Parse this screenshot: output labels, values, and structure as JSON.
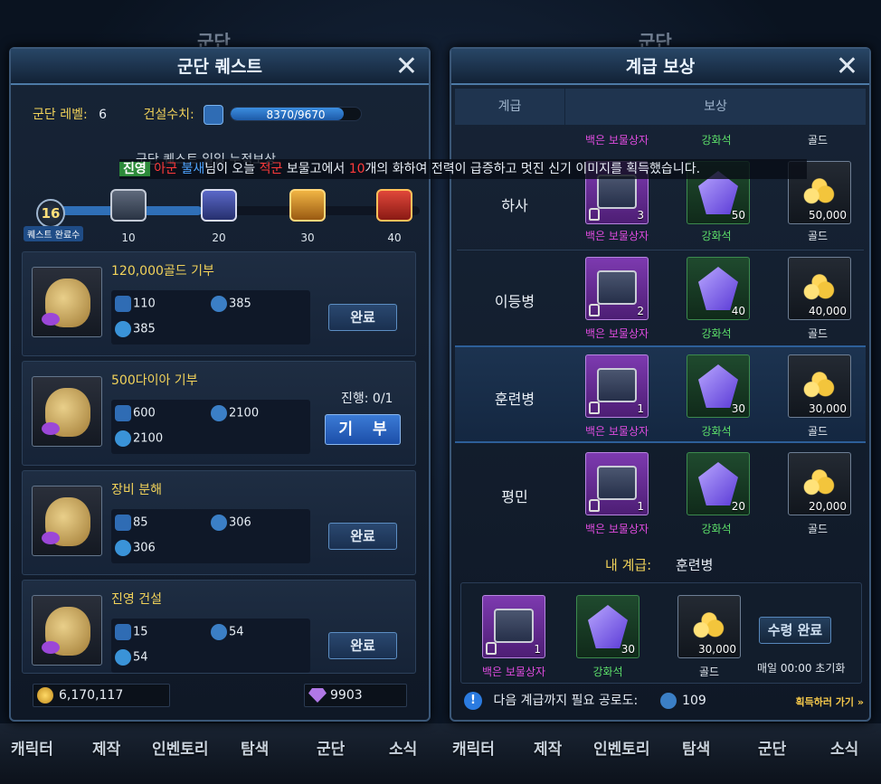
{
  "background": {
    "left_title": "군단",
    "right_title": "군단"
  },
  "bottom_nav": {
    "items": [
      "캐릭터",
      "제작",
      "인벤토리",
      "탐색",
      "군단",
      "소식",
      "캐릭터",
      "제작",
      "인벤토리",
      "탐색",
      "군단",
      "소식"
    ]
  },
  "ticker": {
    "tag": "진영",
    "faction": "아군",
    "player": "불새",
    "msg_1": "님이 오늘",
    "enemy": "적군",
    "msg_2": "보물고에서",
    "count": "10",
    "msg_3": "개의 화하여 전력이 급증하고 멋진 신기 이미지를 획득했습니다."
  },
  "legion_quest": {
    "title": "군단 퀘스트",
    "level_label": "군단 레벨:",
    "level_value": "6",
    "build_label": "건설수치:",
    "build_value": "8370/9670",
    "build_progress": 0.866,
    "daily_reward_caption": "군단 퀘스트 일일 누적보상",
    "completed_count": "16",
    "completed_label": "퀘스트 완료수",
    "milestone_progress": 0.4,
    "milestones": [
      "10",
      "20",
      "30",
      "40"
    ],
    "quests": [
      {
        "title": "120,000골드 기부",
        "build": "110",
        "star": "385",
        "heart": "385",
        "button": "완료"
      },
      {
        "title": "500다이아 기부",
        "build": "600",
        "star": "2100",
        "heart": "2100",
        "progress": "진행: 0/1",
        "button": "기 부"
      },
      {
        "title": "장비 분해",
        "build": "85",
        "star": "306",
        "heart": "306",
        "button": "완료"
      },
      {
        "title": "진영 건설",
        "build": "15",
        "star": "54",
        "heart": "54",
        "button": "완료"
      }
    ],
    "gold": "6,170,117",
    "diamonds": "9903"
  },
  "rank_reward": {
    "title": "계급 보상",
    "col_rank": "계급",
    "col_reward": "보상",
    "top_captions": [
      "백은 보물상자",
      "강화석",
      "골드"
    ],
    "rows": [
      {
        "rank": "하사",
        "box_qty": "3",
        "gem_qty": "50",
        "gold_qty": "50,000"
      },
      {
        "rank": "이등병",
        "box_qty": "2",
        "gem_qty": "40",
        "gold_qty": "40,000"
      },
      {
        "rank": "훈련병",
        "box_qty": "1",
        "gem_qty": "30",
        "gold_qty": "30,000"
      },
      {
        "rank": "평민",
        "box_qty": "1",
        "gem_qty": "20",
        "gold_qty": "20,000"
      }
    ],
    "captions": {
      "box": "백은 보물상자",
      "gem": "강화석",
      "gold": "골드"
    },
    "my_rank_label": "내 계급:",
    "my_rank_value": "훈련병",
    "my_rewards": {
      "box_qty": "1",
      "gem_qty": "30",
      "gold_qty": "30,000"
    },
    "claim_button": "수령 완료",
    "reset_note": "매일 00:00 초기화",
    "need_label": "다음 계급까지 필요 공로도:",
    "need_value": "109",
    "go_link": "획득하러 가기"
  }
}
